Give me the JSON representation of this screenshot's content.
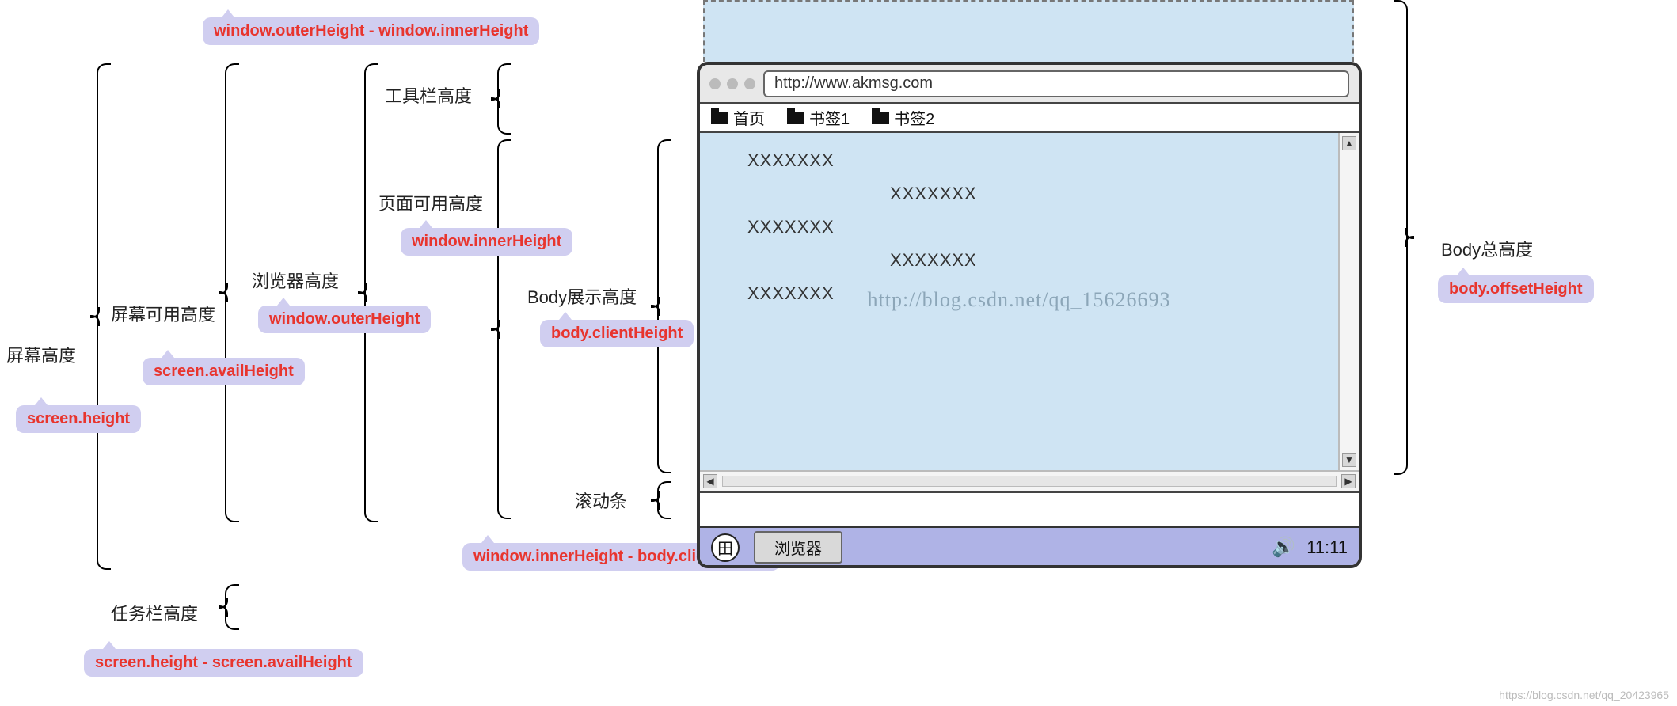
{
  "labels": {
    "screen_height_cn": "屏幕高度",
    "screen_avail_cn": "屏幕可用高度",
    "browser_height_cn": "浏览器高度",
    "toolbar_height_cn": "工具栏高度",
    "page_avail_cn": "页面可用高度",
    "body_visible_cn": "Body展示高度",
    "scrollbar_cn": "滚动条",
    "taskbar_height_cn": "任务栏高度",
    "body_total_cn": "Body总高度"
  },
  "codes": {
    "outer_minus_inner": "window.outerHeight - window.innerHeight",
    "inner_height": "window.innerHeight",
    "outer_height": "window.outerHeight",
    "avail_height": "screen.availHeight",
    "screen_height": "screen.height",
    "client_height": "body.clientHeight",
    "inner_minus_client": "window.innerHeight - body.clientHeight",
    "screen_minus_avail": "screen.height - screen.availHeight",
    "offset_height": "body.offsetHeight"
  },
  "browser": {
    "url": "http://www.akmsg.com",
    "bookmarks": [
      "首页",
      "书签1",
      "书签2"
    ],
    "content_placeholder": "XXXXXXX",
    "watermark": "http://blog.csdn.net/qq_15626693"
  },
  "taskbar": {
    "button": "浏览器",
    "clock": "11:11"
  },
  "footer_watermark": "https://blog.csdn.net/qq_20423965"
}
